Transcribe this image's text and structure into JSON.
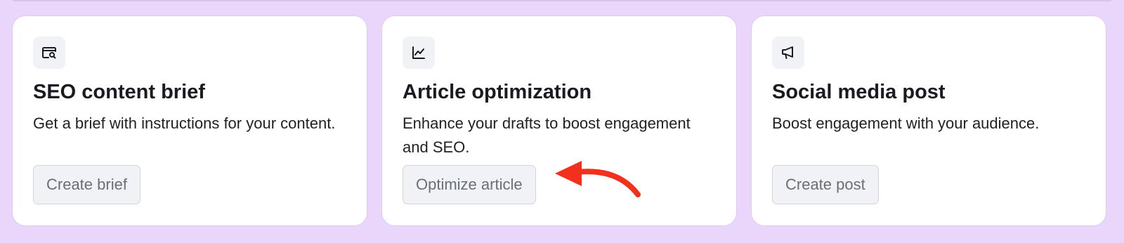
{
  "cards": [
    {
      "icon": "search-document-icon",
      "title": "SEO content brief",
      "description": "Get a brief with instructions for your content.",
      "button_label": "Create brief"
    },
    {
      "icon": "chart-line-icon",
      "title": "Article optimization",
      "description": "Enhance your drafts to boost engagement and SEO.",
      "button_label": "Optimize article"
    },
    {
      "icon": "megaphone-icon",
      "title": "Social media post",
      "description": "Boost engagement with your audience.",
      "button_label": "Create post"
    }
  ],
  "colors": {
    "background": "#ead6fb",
    "card": "#ffffff",
    "button_bg": "#f1f2f5",
    "button_text": "#6b6e78",
    "annotation_arrow": "#f2301b"
  }
}
